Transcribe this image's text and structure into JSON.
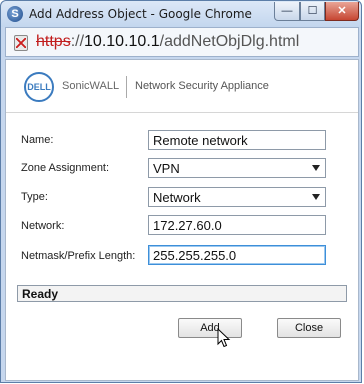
{
  "window": {
    "title": "Add Address Object - Google Chrome",
    "controls": {
      "minimize": "—",
      "maximize": "☐",
      "close": "✕"
    }
  },
  "address_bar": {
    "scheme": "https",
    "separator": "://",
    "host": "10.10.10.1",
    "path": "/addNetObjDlg.html"
  },
  "brand": {
    "logo_text": "DELL",
    "product": "SonicWALL",
    "tagline": "Network Security Appliance"
  },
  "form": {
    "name": {
      "label": "Name:",
      "value": "Remote network"
    },
    "zone": {
      "label": "Zone Assignment:",
      "value": "VPN"
    },
    "type": {
      "label": "Type:",
      "value": "Network"
    },
    "network": {
      "label": "Network:",
      "value": "172.27.60.0"
    },
    "netmask": {
      "label": "Netmask/Prefix Length:",
      "value": "255.255.255.0"
    }
  },
  "status": {
    "text": "Ready"
  },
  "buttons": {
    "add": "Add",
    "close": "Close"
  },
  "colors": {
    "accent": "#3b7bbf",
    "insecure_scheme": "#c11d1d",
    "focus_border": "#3d8fd9"
  }
}
